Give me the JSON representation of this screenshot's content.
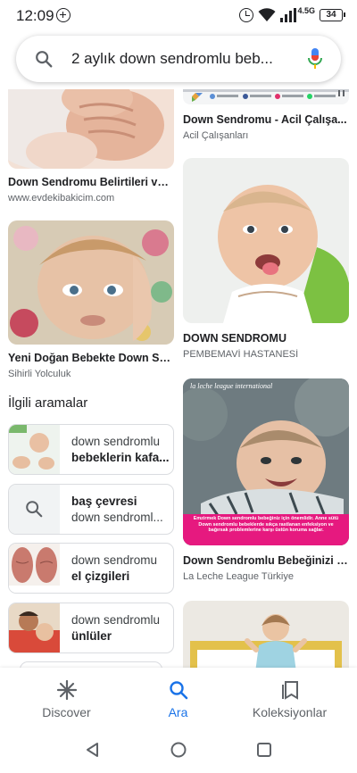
{
  "status_bar": {
    "time": "12:09",
    "network": "4.5G",
    "battery": "34"
  },
  "search": {
    "query": "2 aylık down sendromlu beb..."
  },
  "results": {
    "left": [
      {
        "title": "Down Sendromu Belirtileri ve ...",
        "source": "www.evdekibakicim.com"
      },
      {
        "title": "Yeni Doğan Bebekte Down Se...",
        "source": "Sihirli Yolculuk"
      }
    ],
    "right": [
      {
        "title": "Down Sendromu - Acil Çalışa...",
        "source": "Acil Çalışanları"
      },
      {
        "title": "DOWN SENDROMU",
        "source": "PEMBEMAVİ HASTANESİ"
      },
      {
        "title": "Down Sendromlu Bebeğinizi E...",
        "source": "La Leche League Türkiye",
        "logo": "la leche league international",
        "caption": "Emzirmek Down sendromlu bebeğiniz için önemlidir. Anne sütü Down sendromlu bebeklerde sıkça rastlanan enfeksiyon ve bağırsak problemlerine karşı üstün koruma sağlar."
      }
    ]
  },
  "related": {
    "title": "İlgili aramalar",
    "items": [
      {
        "line1": "down sendromlu",
        "line2": "bebeklerin kafa..."
      },
      {
        "line1": "baş çevresi",
        "line2": "down sendroml..."
      },
      {
        "line1": "down sendromu",
        "line2": "el çizgileri"
      },
      {
        "line1": "down sendromlu",
        "line2": "ünlüler"
      }
    ]
  },
  "bottom_nav": {
    "discover": "Discover",
    "search": "Ara",
    "collections": "Koleksiyonlar"
  },
  "colors": {
    "accent": "#1a73e8",
    "pink": "#e6197f"
  }
}
